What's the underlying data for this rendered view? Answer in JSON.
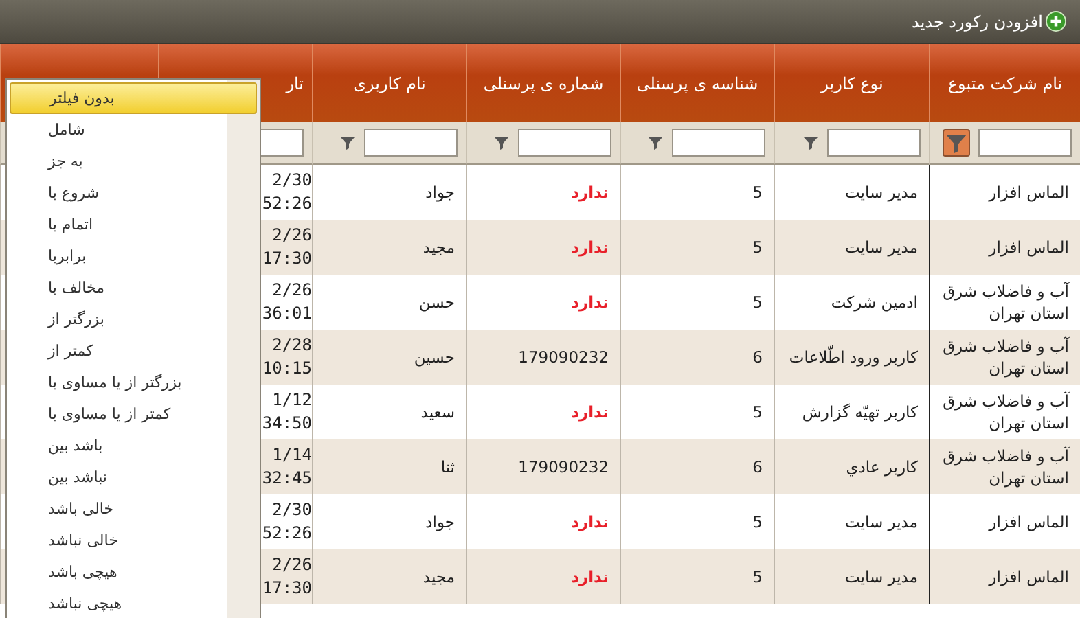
{
  "toolbar": {
    "add_label": "افزودن رکورد جدید"
  },
  "columns": [
    {
      "header": "نام شرکت متبوع",
      "filter_active": true
    },
    {
      "header": "نوع کاربر",
      "filter_active": false
    },
    {
      "header": "شناسه ی پرسنلی",
      "filter_active": false
    },
    {
      "header": "شماره ی پرسنلی",
      "filter_active": false
    },
    {
      "header": "نام کاربری",
      "filter_active": false
    },
    {
      "header": "تار"
    }
  ],
  "rows": [
    {
      "company": "الماس افزار",
      "user_type": "مدیر سایت",
      "personnel_id": "5",
      "personnel_number": "ندارد",
      "missing": true,
      "username": "جواد",
      "date": [
        "2/30",
        "52:26"
      ]
    },
    {
      "company": "الماس افزار",
      "user_type": "مدیر سایت",
      "personnel_id": "5",
      "personnel_number": "ندارد",
      "missing": true,
      "username": "مجید",
      "date": [
        "2/26",
        "17:30"
      ]
    },
    {
      "company": "آب و فاضلاب شرق استان تهران",
      "user_type": "ادمین شرکت",
      "personnel_id": "5",
      "personnel_number": "ندارد",
      "missing": true,
      "username": "حسن",
      "date": [
        "2/26",
        "36:01"
      ]
    },
    {
      "company": "آب و فاضلاب شرق استان تهران",
      "user_type": "کاربر ورود اطّلاعات",
      "personnel_id": "6",
      "personnel_number": "179090232",
      "missing": false,
      "username": "حسین",
      "date": [
        "2/28",
        "10:15"
      ]
    },
    {
      "company": "آب و فاضلاب شرق استان تهران",
      "user_type": "کاربر تهیّه گزارش",
      "personnel_id": "5",
      "personnel_number": "ندارد",
      "missing": true,
      "username": "سعید",
      "date": [
        "1/12",
        "34:50"
      ]
    },
    {
      "company": "آب و فاضلاب شرق استان تهران",
      "user_type": "کاربر عادي",
      "personnel_id": "6",
      "personnel_number": "179090232",
      "missing": false,
      "username": "ثنا",
      "date": [
        "1/14",
        "32:45"
      ]
    },
    {
      "company": "الماس افزار",
      "user_type": "مدیر سایت",
      "personnel_id": "5",
      "personnel_number": "ندارد",
      "missing": true,
      "username": "جواد",
      "date": [
        "2/30",
        "52:26"
      ]
    },
    {
      "company": "الماس افزار",
      "user_type": "مدیر سایت",
      "personnel_id": "5",
      "personnel_number": "ندارد",
      "missing": true,
      "username": "مجید",
      "date": [
        "2/26",
        "17:30"
      ]
    }
  ],
  "filter_menu": [
    {
      "label": "بدون فیلتر",
      "selected": true
    },
    {
      "label": "شامل",
      "selected": false
    },
    {
      "label": "به جز",
      "selected": false
    },
    {
      "label": "شروع با",
      "selected": false
    },
    {
      "label": "اتمام با",
      "selected": false
    },
    {
      "label": "برابربا",
      "selected": false
    },
    {
      "label": "مخالف با",
      "selected": false
    },
    {
      "label": "بزرگتر از",
      "selected": false
    },
    {
      "label": "کمتر از",
      "selected": false
    },
    {
      "label": "بزرگتر از یا مساوی با",
      "selected": false
    },
    {
      "label": "کمتر از یا مساوی با",
      "selected": false
    },
    {
      "label": "باشد بین",
      "selected": false
    },
    {
      "label": "نباشد بین",
      "selected": false
    },
    {
      "label": "خالی باشد",
      "selected": false
    },
    {
      "label": "خالی نباشد",
      "selected": false
    },
    {
      "label": "هیچی باشد",
      "selected": false
    },
    {
      "label": "هیچی نباشد",
      "selected": false
    }
  ]
}
